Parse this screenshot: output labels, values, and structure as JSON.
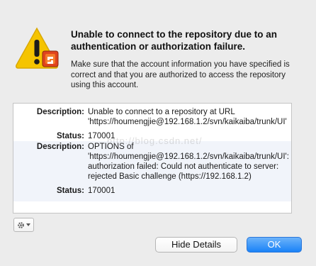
{
  "dialog": {
    "title": "Unable to connect to the repository due to an authentication or authorization failure.",
    "message": "Make sure that the account information you have specified is correct and that you are authorized to access the repository using this account."
  },
  "details": {
    "rows": [
      {
        "key": "Description:",
        "value": "Unable to connect to a repository at URL 'https://houmengjie@192.168.1.2/svn/kaikaiba/trunk/UI'"
      },
      {
        "key": "Status:",
        "value": "170001"
      },
      {
        "key": "Description:",
        "value": "OPTIONS of 'https://houmengjie@192.168.1.2/svn/kaikaiba/trunk/UI': authorization failed: Could not authenticate to server: rejected Basic challenge (https://192.168.1.2)"
      },
      {
        "key": "Status:",
        "value": "170001"
      }
    ],
    "watermark": "http://blog.csdn.net/"
  },
  "buttons": {
    "hide_details": "Hide Details",
    "ok": "OK"
  },
  "icons": {
    "alert": "warning-triangle-icon",
    "gear": "gear-icon",
    "dropdown": "chevron-down-icon"
  },
  "colors": {
    "accent": "#1a82f7",
    "warning": "#f5c400"
  }
}
